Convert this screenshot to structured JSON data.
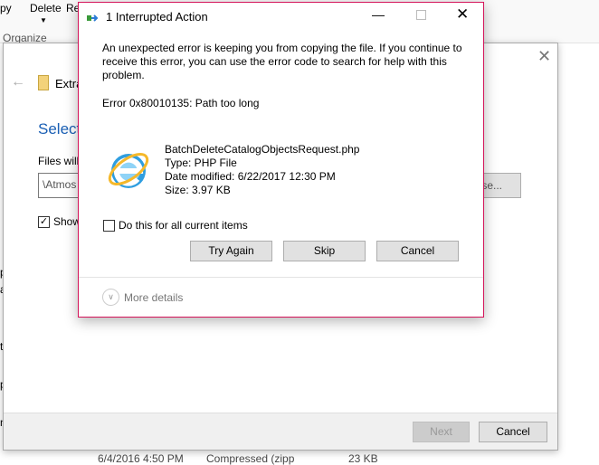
{
  "ribbon": {
    "copy_fragment": "py",
    "delete": "Delete",
    "rename_fragment": "Re",
    "group": "Organize"
  },
  "wizard": {
    "title_fragment": "Extra",
    "heading_fragment": "Select",
    "files_label_fragment": "Files will",
    "path_fragment": "\\Atmos",
    "browse_fragment": "se...",
    "show_fragment": "Show",
    "show_checked": true,
    "next": "Next",
    "cancel": "Cancel"
  },
  "file_row": {
    "date": "6/4/2016 4:50 PM",
    "type": "Compressed (zipp",
    "size": "23 KB"
  },
  "left_fragments": [
    "p",
    "a",
    "t",
    "p",
    "n"
  ],
  "dialog": {
    "title": "1 Interrupted Action",
    "message": "An unexpected error is keeping you from copying the file. If you continue to receive this error, you can use the error code to search for help with this problem.",
    "error": "Error 0x80010135: Path too long",
    "file": {
      "name": "BatchDeleteCatalogObjectsRequest.php",
      "type": "Type: PHP File",
      "modified": "Date modified: 6/22/2017 12:30 PM",
      "size": "Size: 3.97 KB",
      "icon": "internet-explorer-icon"
    },
    "checkbox_label": "Do this for all current items",
    "checkbox_checked": false,
    "buttons": {
      "try_again": "Try Again",
      "skip": "Skip",
      "cancel": "Cancel"
    },
    "more_details": "More details",
    "accent": "#d4145a"
  }
}
